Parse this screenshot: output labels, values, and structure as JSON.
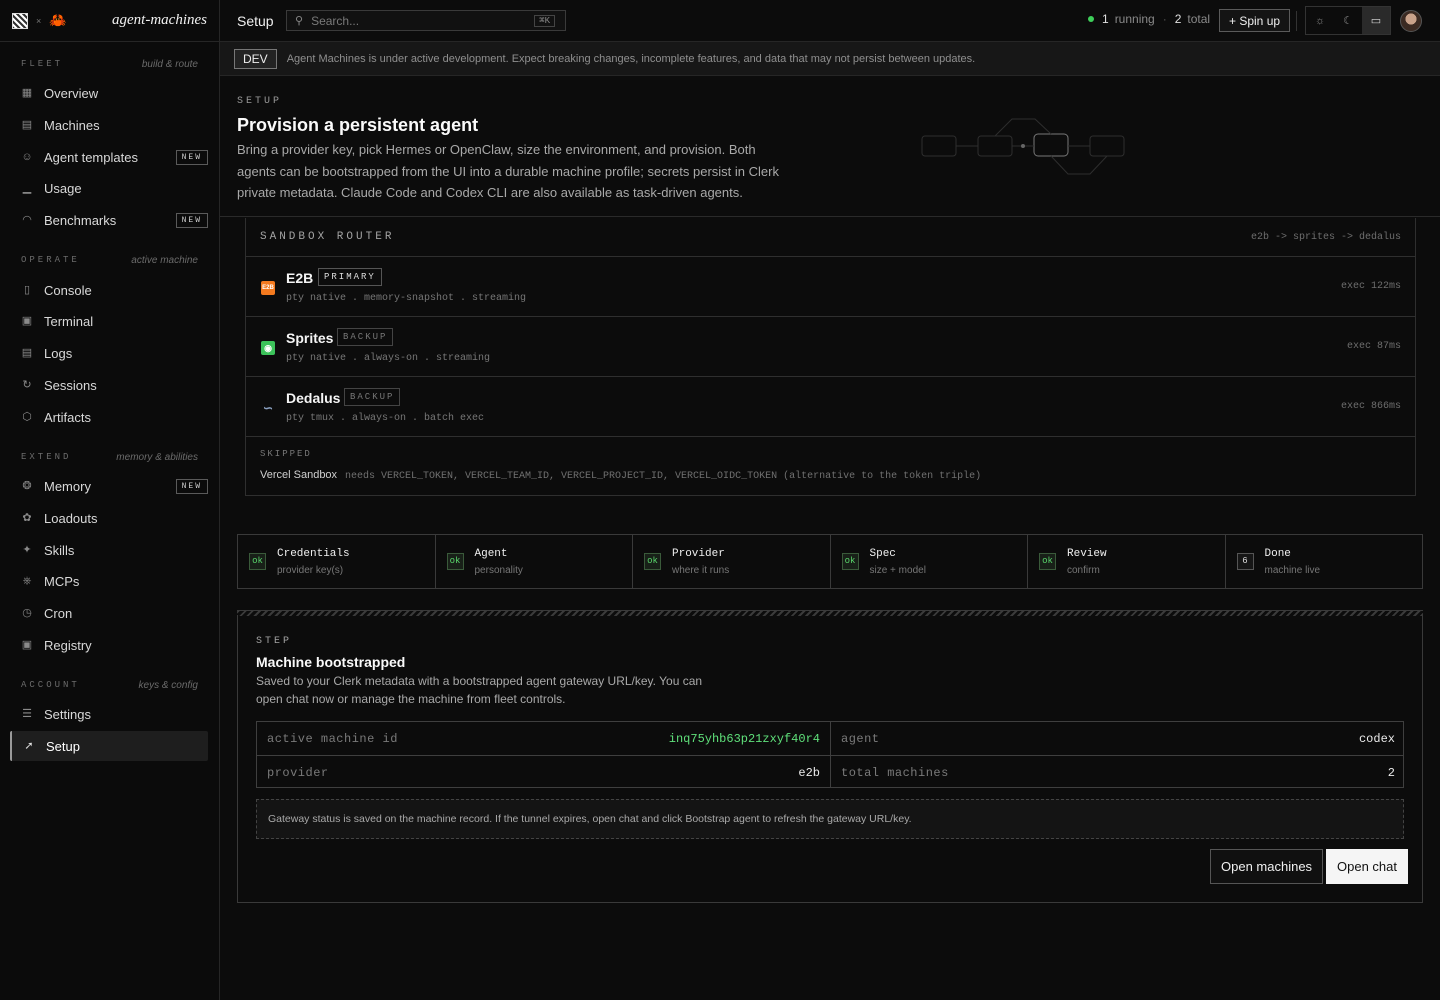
{
  "brand": {
    "x_mark": "×",
    "name": "agent-machines"
  },
  "sidebar": {
    "sections": [
      {
        "title": "FLEET",
        "note": "build & route"
      },
      {
        "title": "OPERATE",
        "note": "active machine"
      },
      {
        "title": "EXTEND",
        "note": "memory & abilities"
      },
      {
        "title": "ACCOUNT",
        "note": "keys & config"
      }
    ],
    "items": [
      {
        "label": "Overview",
        "icon": "grid-icon"
      },
      {
        "label": "Machines",
        "icon": "server-icon"
      },
      {
        "label": "Agent templates",
        "icon": "user-icon",
        "badge": "NEW"
      },
      {
        "label": "Usage",
        "icon": "bar-chart-icon"
      },
      {
        "label": "Benchmarks",
        "icon": "gauge-icon",
        "badge": "NEW"
      },
      {
        "label": "Console",
        "icon": "chat-icon"
      },
      {
        "label": "Terminal",
        "icon": "terminal-icon"
      },
      {
        "label": "Logs",
        "icon": "file-icon"
      },
      {
        "label": "Sessions",
        "icon": "history-icon"
      },
      {
        "label": "Artifacts",
        "icon": "box-icon"
      },
      {
        "label": "Memory",
        "icon": "brain-icon",
        "badge": "NEW"
      },
      {
        "label": "Loadouts",
        "icon": "layers-icon"
      },
      {
        "label": "Skills",
        "icon": "sparkles-icon"
      },
      {
        "label": "MCPs",
        "icon": "plug-icon"
      },
      {
        "label": "Cron",
        "icon": "clock-icon"
      },
      {
        "label": "Registry",
        "icon": "package-icon"
      },
      {
        "label": "Settings",
        "icon": "sliders-icon"
      },
      {
        "label": "Setup",
        "icon": "rocket-icon"
      }
    ]
  },
  "topbar": {
    "title": "Setup",
    "search_placeholder": "Search...",
    "search_shortcut": "⌘K",
    "running_count": "1",
    "running_label": "running",
    "separator": "·",
    "total_count": "2",
    "total_label": "total",
    "spin_label": "+ Spin up"
  },
  "banner": {
    "tag": "DEV",
    "text": "Agent Machines is under active development. Expect breaking changes, incomplete features, and data that may not persist between updates."
  },
  "hero": {
    "kicker": "SETUP",
    "title": "Provision a persistent agent",
    "description": "Bring a provider key, pick Hermes or OpenClaw, size the environment, and provision. Both agents can be bootstrapped from the UI into a durable machine profile; secrets persist in Clerk private metadata. Claude Code and Codex CLI are also available as task-driven agents."
  },
  "router": {
    "title": "SANDBOX ROUTER",
    "chain": "e2b -> sprites -> dedalus",
    "providers": [
      {
        "name": "E2B",
        "tag": "PRIMARY",
        "features": "pty native . memory-snapshot . streaming",
        "exec": "exec 122ms",
        "icon_text": "E2B",
        "color": "#f47a1f"
      },
      {
        "name": "Sprites",
        "tag": "BACKUP",
        "features": "pty native . always-on . streaming",
        "exec": "exec 87ms",
        "icon_text": "",
        "color": "#3cc35a"
      },
      {
        "name": "Dedalus",
        "tag": "BACKUP",
        "features": "pty tmux . always-on . batch exec",
        "exec": "exec 866ms",
        "icon_text": "",
        "color": "#8aa0c0"
      }
    ],
    "skipped_label": "SKIPPED",
    "skipped_name": "Vercel Sandbox",
    "skipped_needs": "needs VERCEL_TOKEN, VERCEL_TEAM_ID, VERCEL_PROJECT_ID, VERCEL_OIDC_TOKEN (alternative to the token triple)"
  },
  "steps": [
    {
      "mark": "ok",
      "name": "Credentials",
      "sub": "provider key(s)"
    },
    {
      "mark": "ok",
      "name": "Agent",
      "sub": "personality"
    },
    {
      "mark": "ok",
      "name": "Provider",
      "sub": "where it runs"
    },
    {
      "mark": "ok",
      "name": "Spec",
      "sub": "size + model"
    },
    {
      "mark": "ok",
      "name": "Review",
      "sub": "confirm"
    },
    {
      "mark": "6",
      "name": "Done",
      "sub": "machine live"
    }
  ],
  "step_panel": {
    "kicker": "STEP",
    "title": "Machine bootstrapped",
    "description": "Saved to your Clerk metadata with a bootstrapped agent gateway URL/key. You can open chat now or manage the machine from fleet controls.",
    "fields": {
      "machine_id_label": "active machine id",
      "machine_id": "inq75yhb63p21zxyf40r4",
      "agent_label": "agent",
      "agent": "codex",
      "provider_label": "provider",
      "provider": "e2b",
      "total_label": "total machines",
      "total": "2"
    },
    "note": "Gateway status is saved on the machine record. If the tunnel expires, open chat and click Bootstrap agent to refresh the gateway URL/key.",
    "open_machines": "Open machines",
    "open_chat": "Open chat"
  }
}
